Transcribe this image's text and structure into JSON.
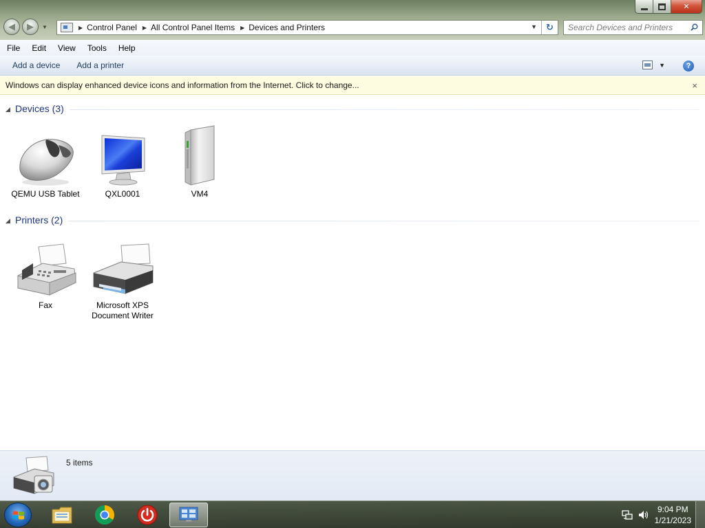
{
  "window": {
    "breadcrumb": [
      "Control Panel",
      "All Control Panel Items",
      "Devices and Printers"
    ],
    "search_placeholder": "Search Devices and Printers"
  },
  "menu": [
    "File",
    "Edit",
    "View",
    "Tools",
    "Help"
  ],
  "commands": {
    "add_device": "Add a device",
    "add_printer": "Add a printer"
  },
  "infobar": {
    "message": "Windows can display enhanced device icons and information from the Internet. Click to change...",
    "close": "×"
  },
  "groups": {
    "devices": {
      "title": "Devices (3)",
      "items": [
        {
          "label": "QEMU USB Tablet",
          "icon": "mouse-icon"
        },
        {
          "label": "QXL0001",
          "icon": "monitor-icon"
        },
        {
          "label": "VM4",
          "icon": "computer-tower-icon"
        }
      ]
    },
    "printers": {
      "title": "Printers (2)",
      "items": [
        {
          "label": "Fax",
          "icon": "fax-icon"
        },
        {
          "label": "Microsoft XPS Document Writer",
          "icon": "printer-icon"
        }
      ]
    }
  },
  "details": {
    "count": "5 items",
    "icon": "devices-printers-icon"
  },
  "taskbar": {
    "pinned": [
      "windows-explorer-icon",
      "chrome-icon",
      "power-icon",
      "devices-printers-icon"
    ],
    "clock_time": "9:04 PM",
    "clock_date": "1/21/2023"
  }
}
